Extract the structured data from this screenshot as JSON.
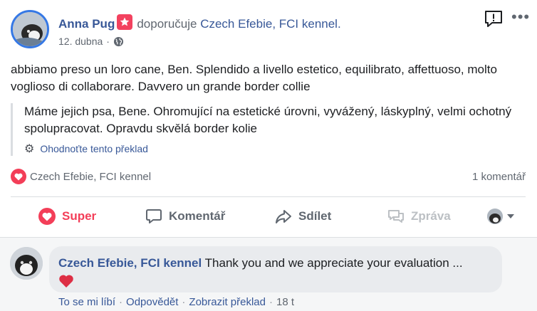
{
  "post": {
    "author": "Anna Pug",
    "action_text": "doporučuje",
    "page_name": "Czech Efebie, FCI kennel.",
    "date": "12. dubna",
    "separator": "·",
    "original_text": "abbiamo preso un loro cane, Ben. Splendido a livello estetico, equilibrato, affettuoso, molto voglioso di collaborare. Davvero un grande border collie",
    "translated_text": "Máme jejich psa, Bene. Ohromující na estetické úrovni, vyvážený, láskyplný, velmi ochotný spolupracovat. Opravdu skvělá border kolie",
    "rate_translation": "Ohodnoťte tento překlad"
  },
  "summary": {
    "reactor": "Czech Efebie, FCI kennel",
    "comment_count": "1 komentář"
  },
  "actions": {
    "super": "Super",
    "comment": "Komentář",
    "share": "Sdílet",
    "message": "Zpráva"
  },
  "comment": {
    "author": "Czech Efebie, FCI kennel",
    "text": "Thank you and we appreciate your evaluation ...",
    "like": "To se mi líbí",
    "reply": "Odpovědět",
    "translate": "Zobrazit překlad",
    "time": "18 t",
    "separator": "·"
  },
  "colors": {
    "link": "#385898",
    "super_red": "#f33e58",
    "secondary_text": "#606770",
    "comment_bg": "#e9ebee"
  },
  "icons": [
    "recommend-icon",
    "globe-icon",
    "report-icon",
    "more-icon",
    "gear-icon",
    "heart-icon",
    "comment-icon",
    "share-icon",
    "message-icon",
    "caret-down-icon"
  ]
}
